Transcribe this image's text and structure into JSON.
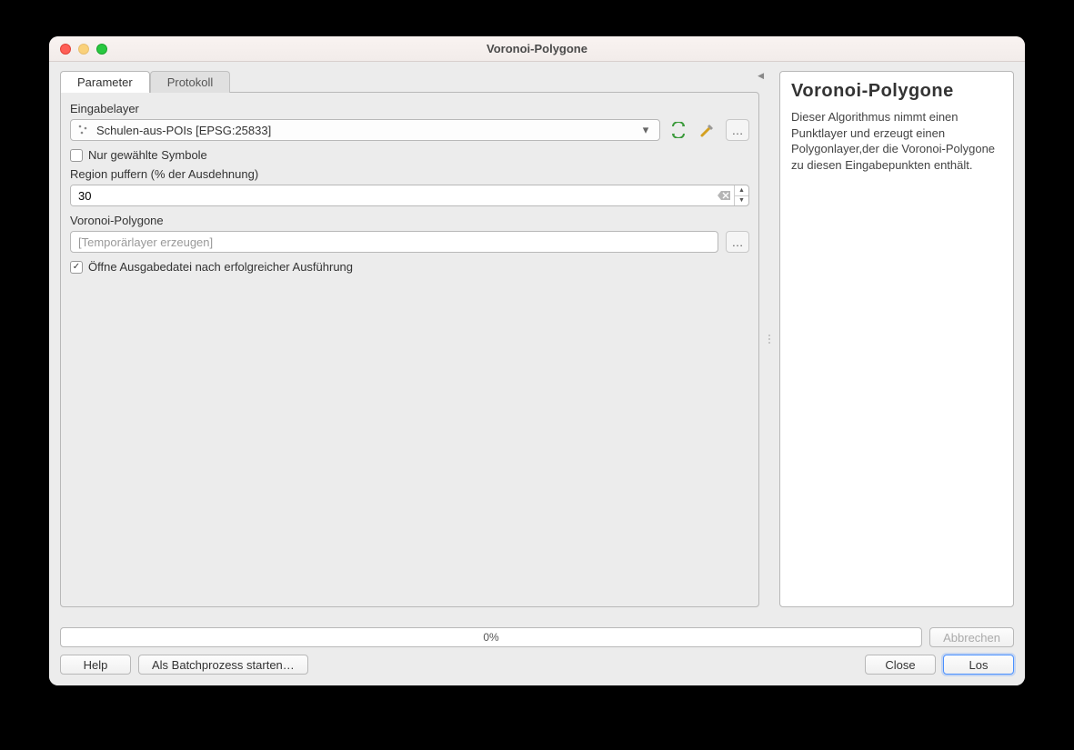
{
  "window": {
    "title": "Voronoi-Polygone"
  },
  "tabs": {
    "parameter": "Parameter",
    "protokoll": "Protokoll"
  },
  "fields": {
    "eingabelayer_label": "Eingabelayer",
    "eingabelayer_value": "Schulen-aus-POIs [EPSG:25833]",
    "nur_gewaehlt": "Nur gewählte Symbole",
    "region_label": "Region puffern (% der Ausdehnung)",
    "region_value": "30",
    "voronoi_label": "Voronoi-Polygone",
    "voronoi_placeholder": "[Temporärlayer erzeugen]",
    "open_after": "Öffne Ausgabedatei nach erfolgreicher Ausführung"
  },
  "help": {
    "title": "Voronoi-Polygone",
    "body": "Dieser Algorithmus nimmt einen Punktlayer und erzeugt einen Polygonlayer,der die Voronoi-Polygone zu diesen Eingabepunkten enthält."
  },
  "progress": {
    "text": "0%"
  },
  "buttons": {
    "abbrechen": "Abbrechen",
    "help": "Help",
    "batch": "Als Batchprozess starten…",
    "close": "Close",
    "los": "Los"
  },
  "icons": {
    "iterate": "iterate",
    "advanced": "advanced",
    "browse": "…"
  }
}
